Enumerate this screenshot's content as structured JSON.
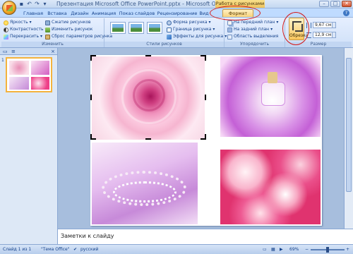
{
  "window": {
    "doc_title": "Презентация Microsoft Office PowerPoint.pptx - Microsoft Office PowerPoint...",
    "context_title": "Работа с рисунками",
    "win_min": "–",
    "win_max": "□",
    "win_close": "✕"
  },
  "tabs": [
    {
      "label": "Главная"
    },
    {
      "label": "Вставка"
    },
    {
      "label": "Дизайн"
    },
    {
      "label": "Анимация"
    },
    {
      "label": "Показ слайдов"
    },
    {
      "label": "Рецензирование"
    },
    {
      "label": "Вид"
    },
    {
      "label": "Формат",
      "active": true
    }
  ],
  "help_label": "?",
  "ribbon": {
    "adjust": {
      "label": "Изменить",
      "brightness": "Яркость",
      "contrast": "Контрастность",
      "recolor": "Перекрасить",
      "compress": "Сжатие рисунков",
      "change": "Изменить рисунок",
      "reset": "Сброс параметров рисунка"
    },
    "styles": {
      "label": "Стили рисунков",
      "shape": "Форма рисунка",
      "border": "Граница рисунка",
      "effects": "Эффекты для рисунка"
    },
    "arrange": {
      "label": "Упорядочить",
      "front": "На передний план",
      "back": "На задний план",
      "pane": "Область выделения"
    },
    "size": {
      "label": "Размер",
      "crop": "Обрезка",
      "height": "9,67 см",
      "width": "12,9 см"
    }
  },
  "left_pane": {
    "slide_number": "1",
    "close": "×"
  },
  "notes": {
    "placeholder": "Заметки к слайду"
  },
  "status": {
    "slide": "Слайд 1 из 1",
    "theme": "\"Тема Office\"",
    "language": "русский",
    "zoom": "69%",
    "zoom_fraction": 0.5
  }
}
